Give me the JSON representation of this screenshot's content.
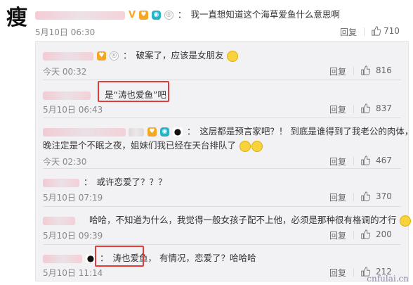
{
  "main": {
    "avatar_char": "瘦",
    "colon": "：",
    "text": "我一直想知道这个海草爱鱼什么意思啊",
    "time": "5月10日 06:30",
    "reply_label": "回复",
    "likes": "710"
  },
  "replies": [
    {
      "text": "破案了，应该是女朋友",
      "time": "今天 00:32",
      "reply_label": "回复",
      "likes": "816"
    },
    {
      "text": "是“涛也爱鱼”吧",
      "time": "5月10日 06:43",
      "reply_label": "回复",
      "likes": "837"
    },
    {
      "text_line1": "这层都是预言家吧？！ 到底是谁得到了我老公的肉体，今",
      "text_line2": "晚注定是个不眠之夜，姐妹们我已经在天台排队了",
      "time": "今天 02:30",
      "reply_label": "回复",
      "likes": "467"
    },
    {
      "text": "或许恋爱了？？？",
      "time": "5月10日 07:19",
      "reply_label": "回复",
      "likes": "370"
    },
    {
      "text": "哈哈，不知道为什么，我觉得一般女孩子配不上他，必须是那种很有格调的才行",
      "time": "5月10日 09:39",
      "reply_label": "回复",
      "likes": "200"
    },
    {
      "text_highlight": "涛也爱鱼，",
      "text_rest": "有情况，恋爱了？哈哈哈",
      "time": "5月10日 11:14",
      "reply_label": "回复",
      "likes": "212"
    }
  ],
  "watermark": "cnfulai.cn"
}
